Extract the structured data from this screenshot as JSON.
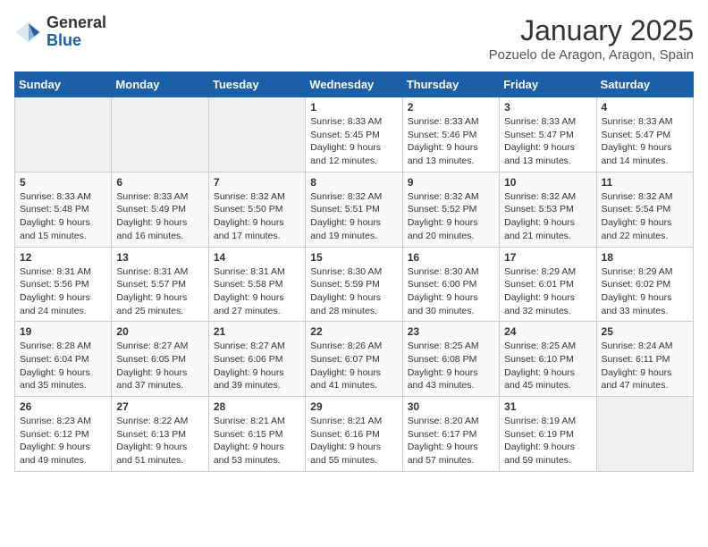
{
  "logo": {
    "general": "General",
    "blue": "Blue"
  },
  "header": {
    "month": "January 2025",
    "location": "Pozuelo de Aragon, Aragon, Spain"
  },
  "weekdays": [
    "Sunday",
    "Monday",
    "Tuesday",
    "Wednesday",
    "Thursday",
    "Friday",
    "Saturday"
  ],
  "weeks": [
    [
      {
        "day": "",
        "sunrise": "",
        "sunset": "",
        "daylight": "",
        "empty": true
      },
      {
        "day": "",
        "sunrise": "",
        "sunset": "",
        "daylight": "",
        "empty": true
      },
      {
        "day": "",
        "sunrise": "",
        "sunset": "",
        "daylight": "",
        "empty": true
      },
      {
        "day": "1",
        "sunrise": "Sunrise: 8:33 AM",
        "sunset": "Sunset: 5:45 PM",
        "daylight": "Daylight: 9 hours and 12 minutes."
      },
      {
        "day": "2",
        "sunrise": "Sunrise: 8:33 AM",
        "sunset": "Sunset: 5:46 PM",
        "daylight": "Daylight: 9 hours and 13 minutes."
      },
      {
        "day": "3",
        "sunrise": "Sunrise: 8:33 AM",
        "sunset": "Sunset: 5:47 PM",
        "daylight": "Daylight: 9 hours and 13 minutes."
      },
      {
        "day": "4",
        "sunrise": "Sunrise: 8:33 AM",
        "sunset": "Sunset: 5:47 PM",
        "daylight": "Daylight: 9 hours and 14 minutes."
      }
    ],
    [
      {
        "day": "5",
        "sunrise": "Sunrise: 8:33 AM",
        "sunset": "Sunset: 5:48 PM",
        "daylight": "Daylight: 9 hours and 15 minutes."
      },
      {
        "day": "6",
        "sunrise": "Sunrise: 8:33 AM",
        "sunset": "Sunset: 5:49 PM",
        "daylight": "Daylight: 9 hours and 16 minutes."
      },
      {
        "day": "7",
        "sunrise": "Sunrise: 8:32 AM",
        "sunset": "Sunset: 5:50 PM",
        "daylight": "Daylight: 9 hours and 17 minutes."
      },
      {
        "day": "8",
        "sunrise": "Sunrise: 8:32 AM",
        "sunset": "Sunset: 5:51 PM",
        "daylight": "Daylight: 9 hours and 19 minutes."
      },
      {
        "day": "9",
        "sunrise": "Sunrise: 8:32 AM",
        "sunset": "Sunset: 5:52 PM",
        "daylight": "Daylight: 9 hours and 20 minutes."
      },
      {
        "day": "10",
        "sunrise": "Sunrise: 8:32 AM",
        "sunset": "Sunset: 5:53 PM",
        "daylight": "Daylight: 9 hours and 21 minutes."
      },
      {
        "day": "11",
        "sunrise": "Sunrise: 8:32 AM",
        "sunset": "Sunset: 5:54 PM",
        "daylight": "Daylight: 9 hours and 22 minutes."
      }
    ],
    [
      {
        "day": "12",
        "sunrise": "Sunrise: 8:31 AM",
        "sunset": "Sunset: 5:56 PM",
        "daylight": "Daylight: 9 hours and 24 minutes."
      },
      {
        "day": "13",
        "sunrise": "Sunrise: 8:31 AM",
        "sunset": "Sunset: 5:57 PM",
        "daylight": "Daylight: 9 hours and 25 minutes."
      },
      {
        "day": "14",
        "sunrise": "Sunrise: 8:31 AM",
        "sunset": "Sunset: 5:58 PM",
        "daylight": "Daylight: 9 hours and 27 minutes."
      },
      {
        "day": "15",
        "sunrise": "Sunrise: 8:30 AM",
        "sunset": "Sunset: 5:59 PM",
        "daylight": "Daylight: 9 hours and 28 minutes."
      },
      {
        "day": "16",
        "sunrise": "Sunrise: 8:30 AM",
        "sunset": "Sunset: 6:00 PM",
        "daylight": "Daylight: 9 hours and 30 minutes."
      },
      {
        "day": "17",
        "sunrise": "Sunrise: 8:29 AM",
        "sunset": "Sunset: 6:01 PM",
        "daylight": "Daylight: 9 hours and 32 minutes."
      },
      {
        "day": "18",
        "sunrise": "Sunrise: 8:29 AM",
        "sunset": "Sunset: 6:02 PM",
        "daylight": "Daylight: 9 hours and 33 minutes."
      }
    ],
    [
      {
        "day": "19",
        "sunrise": "Sunrise: 8:28 AM",
        "sunset": "Sunset: 6:04 PM",
        "daylight": "Daylight: 9 hours and 35 minutes."
      },
      {
        "day": "20",
        "sunrise": "Sunrise: 8:27 AM",
        "sunset": "Sunset: 6:05 PM",
        "daylight": "Daylight: 9 hours and 37 minutes."
      },
      {
        "day": "21",
        "sunrise": "Sunrise: 8:27 AM",
        "sunset": "Sunset: 6:06 PM",
        "daylight": "Daylight: 9 hours and 39 minutes."
      },
      {
        "day": "22",
        "sunrise": "Sunrise: 8:26 AM",
        "sunset": "Sunset: 6:07 PM",
        "daylight": "Daylight: 9 hours and 41 minutes."
      },
      {
        "day": "23",
        "sunrise": "Sunrise: 8:25 AM",
        "sunset": "Sunset: 6:08 PM",
        "daylight": "Daylight: 9 hours and 43 minutes."
      },
      {
        "day": "24",
        "sunrise": "Sunrise: 8:25 AM",
        "sunset": "Sunset: 6:10 PM",
        "daylight": "Daylight: 9 hours and 45 minutes."
      },
      {
        "day": "25",
        "sunrise": "Sunrise: 8:24 AM",
        "sunset": "Sunset: 6:11 PM",
        "daylight": "Daylight: 9 hours and 47 minutes."
      }
    ],
    [
      {
        "day": "26",
        "sunrise": "Sunrise: 8:23 AM",
        "sunset": "Sunset: 6:12 PM",
        "daylight": "Daylight: 9 hours and 49 minutes."
      },
      {
        "day": "27",
        "sunrise": "Sunrise: 8:22 AM",
        "sunset": "Sunset: 6:13 PM",
        "daylight": "Daylight: 9 hours and 51 minutes."
      },
      {
        "day": "28",
        "sunrise": "Sunrise: 8:21 AM",
        "sunset": "Sunset: 6:15 PM",
        "daylight": "Daylight: 9 hours and 53 minutes."
      },
      {
        "day": "29",
        "sunrise": "Sunrise: 8:21 AM",
        "sunset": "Sunset: 6:16 PM",
        "daylight": "Daylight: 9 hours and 55 minutes."
      },
      {
        "day": "30",
        "sunrise": "Sunrise: 8:20 AM",
        "sunset": "Sunset: 6:17 PM",
        "daylight": "Daylight: 9 hours and 57 minutes."
      },
      {
        "day": "31",
        "sunrise": "Sunrise: 8:19 AM",
        "sunset": "Sunset: 6:19 PM",
        "daylight": "Daylight: 9 hours and 59 minutes."
      },
      {
        "day": "",
        "sunrise": "",
        "sunset": "",
        "daylight": "",
        "empty": true
      }
    ]
  ]
}
